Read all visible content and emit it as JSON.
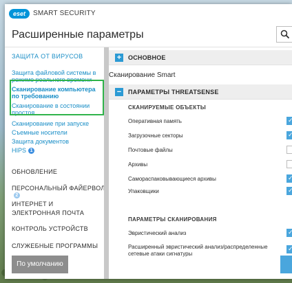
{
  "app": {
    "brand": "eset",
    "product": "SMART SECURITY"
  },
  "header": {
    "title": "Расширенные параметры"
  },
  "sidebar": {
    "antivirus": "ЗАЩИТА ОТ ВИРУСОВ",
    "items": [
      "Защита файловой системы в режиме реального времени",
      "Сканирование компьютера по требованию",
      "Сканирование в состоянии простоя",
      "Сканирование при запуске",
      "Съемные носители",
      "Защита документов",
      "HIPS"
    ],
    "hips_badge": "1",
    "sections": [
      "ОБНОВЛЕНИЕ",
      "ПЕРСОНАЛЬНЫЙ ФАЙЕРВОЛ",
      "ИНТЕРНЕТ И ЭЛЕКТРОННАЯ ПОЧТА",
      "КОНТРОЛЬ УСТРОЙСТВ",
      "СЛУЖЕБНЫЕ ПРОГРАММЫ"
    ],
    "firewall_badge": "2"
  },
  "content": {
    "basic": "ОСНОВНОЕ",
    "crumb": "Сканирование Smart",
    "threatsense": "ПАРАМЕТРЫ THREATSENSE",
    "objects_header": "СКАНИРУЕМЫЕ ОБЪЕКТЫ",
    "objects": [
      {
        "label": "Оперативная память",
        "on": true
      },
      {
        "label": "Загрузочные секторы",
        "on": true
      },
      {
        "label": "Почтовые файлы",
        "on": false
      },
      {
        "label": "Архивы",
        "on": false
      },
      {
        "label": "Самораспаковывающиеся архивы",
        "on": true
      },
      {
        "label": "Упаковщики",
        "on": true
      }
    ],
    "scan_header": "ПАРАМЕТРЫ СКАНИРОВАНИЯ",
    "scan_options": [
      {
        "label": "Эвристический анализ",
        "on": true
      },
      {
        "label": "Расширенный эвристический анализ/распределенные сетевые атаки сигнатуры",
        "on": true
      }
    ]
  },
  "footer": {
    "default_label": "По умолчанию"
  },
  "colors": {
    "accent": "#2b9ad4",
    "highlight": "#2fb34a",
    "link": "#1c8fc7"
  }
}
